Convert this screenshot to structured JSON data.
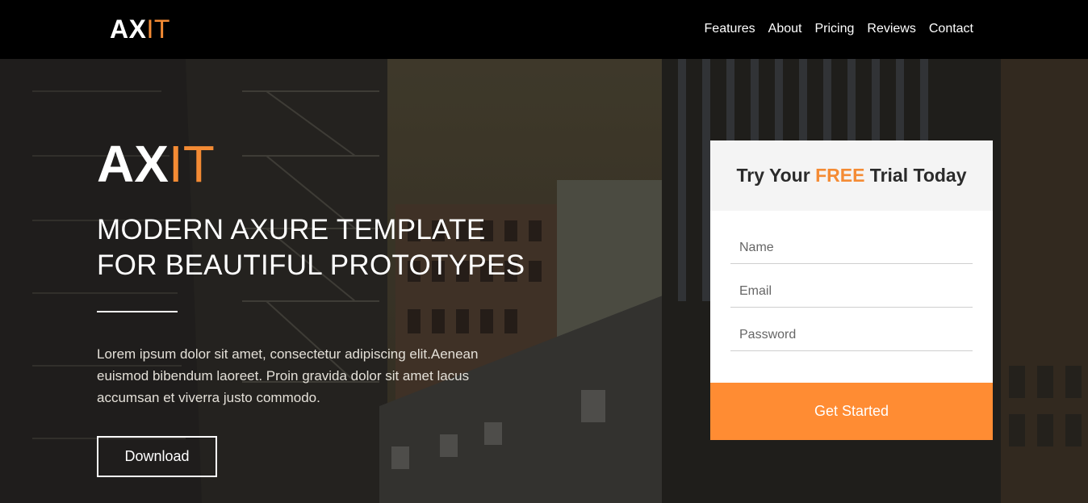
{
  "brand": {
    "logo_main": "AX",
    "logo_accent": "IT"
  },
  "nav": {
    "items": [
      "Features",
      "About",
      "Pricing",
      "Reviews",
      "Contact"
    ]
  },
  "hero": {
    "logo_main": "AX",
    "logo_accent": "IT",
    "headline_line1": "MODERN AXURE TEMPLATE",
    "headline_line2": "FOR BEAUTIFUL PROTOTYPES",
    "description": "Lorem ipsum dolor sit amet, consectetur adipiscing elit.Aenean euismod bibendum laoreet. Proin gravida dolor sit amet lacus accumsan et viverra justo commodo.",
    "download_label": "Download"
  },
  "form": {
    "title_prefix": "Try Your ",
    "title_highlight": "FREE",
    "title_suffix": " Trial Today",
    "name_placeholder": "Name",
    "email_placeholder": "Email",
    "password_placeholder": "Password",
    "submit_label": "Get Started"
  },
  "colors": {
    "accent": "#f48b34",
    "button": "#ff8c33",
    "topbar": "#000000"
  }
}
